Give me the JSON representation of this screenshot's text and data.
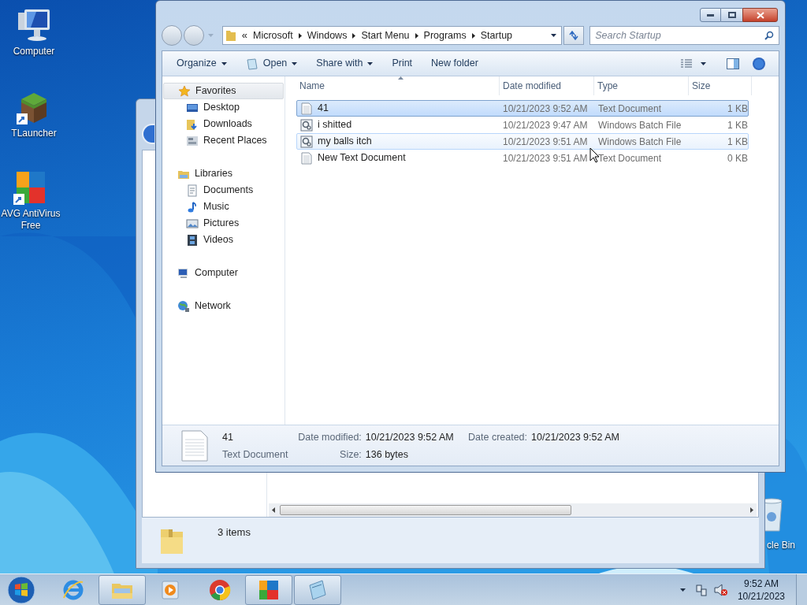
{
  "desktop_icons": [
    {
      "label": "Computer",
      "kind": "computer"
    },
    {
      "label": "TLauncher",
      "kind": "grass"
    },
    {
      "label": "AVG AntiVirus Free",
      "kind": "avg"
    }
  ],
  "recycle_bin": {
    "label": "cle Bin"
  },
  "background_window": {
    "status": "3 items"
  },
  "explorer": {
    "breadcrumb": {
      "overflow": "«",
      "parts": [
        "Microsoft",
        "Windows",
        "Start Menu",
        "Programs",
        "Startup"
      ]
    },
    "search_placeholder": "Search Startup",
    "toolbar": [
      {
        "label": "Organize",
        "dropdown": true,
        "kind": "plain"
      },
      {
        "label": "Open",
        "dropdown": true,
        "kind": "open"
      },
      {
        "label": "Share with",
        "dropdown": true,
        "kind": "plain"
      },
      {
        "label": "Print",
        "dropdown": false,
        "kind": "plain"
      },
      {
        "label": "New folder",
        "dropdown": false,
        "kind": "plain"
      }
    ],
    "nav": [
      {
        "label": "Favorites",
        "kind": "star",
        "selected": true,
        "children": [
          {
            "label": "Desktop",
            "kind": "desktop",
            "selected": false
          },
          {
            "label": "Downloads",
            "kind": "downloads",
            "selected": false
          },
          {
            "label": "Recent Places",
            "kind": "recent",
            "selected": false
          }
        ]
      },
      {
        "label": "Libraries",
        "kind": "library",
        "selected": false,
        "children": [
          {
            "label": "Documents",
            "kind": "documents",
            "selected": false
          },
          {
            "label": "Music",
            "kind": "music",
            "selected": false
          },
          {
            "label": "Pictures",
            "kind": "pictures",
            "selected": false
          },
          {
            "label": "Videos",
            "kind": "videos",
            "selected": false
          }
        ]
      },
      {
        "label": "Computer",
        "kind": "computer",
        "selected": false
      },
      {
        "label": "Network",
        "kind": "network",
        "selected": false
      }
    ],
    "columns": [
      {
        "label": "Name",
        "sorted": true
      },
      {
        "label": "Date modified",
        "sorted": false
      },
      {
        "label": "Type",
        "sorted": false
      },
      {
        "label": "Size",
        "sorted": false
      }
    ],
    "rows": [
      {
        "name": "41",
        "date": "10/21/2023 9:52 AM",
        "type": "Text Document",
        "size": "1 KB",
        "kind": "text",
        "selected": true,
        "hover": false
      },
      {
        "name": "i shitted",
        "date": "10/21/2023 9:47 AM",
        "type": "Windows Batch File",
        "size": "1 KB",
        "kind": "batch",
        "selected": false,
        "hover": false
      },
      {
        "name": "my balls itch",
        "date": "10/21/2023 9:51 AM",
        "type": "Windows Batch File",
        "size": "1 KB",
        "kind": "batch",
        "selected": false,
        "hover": true
      },
      {
        "name": "New Text Document",
        "date": "10/21/2023 9:51 AM",
        "type": "Text Document",
        "size": "0 KB",
        "kind": "text",
        "selected": false,
        "hover": false
      }
    ],
    "details": {
      "name": "41",
      "type": "Text Document",
      "fields": [
        {
          "label": "Date modified:",
          "value": "10/21/2023 9:52 AM"
        },
        {
          "label": "Date created:",
          "value": "10/21/2023 9:52 AM"
        },
        {
          "label": "Size:",
          "value": "136 bytes"
        }
      ]
    }
  },
  "taskbar": {
    "items": [
      {
        "kind": "ie",
        "active": false
      },
      {
        "kind": "explorer",
        "active": true
      },
      {
        "kind": "media",
        "active": false
      },
      {
        "kind": "chrome",
        "active": false
      },
      {
        "kind": "avg",
        "active": true
      },
      {
        "kind": "notepad",
        "active": true
      }
    ],
    "time": "9:52 AM",
    "date": "10/21/2023"
  }
}
